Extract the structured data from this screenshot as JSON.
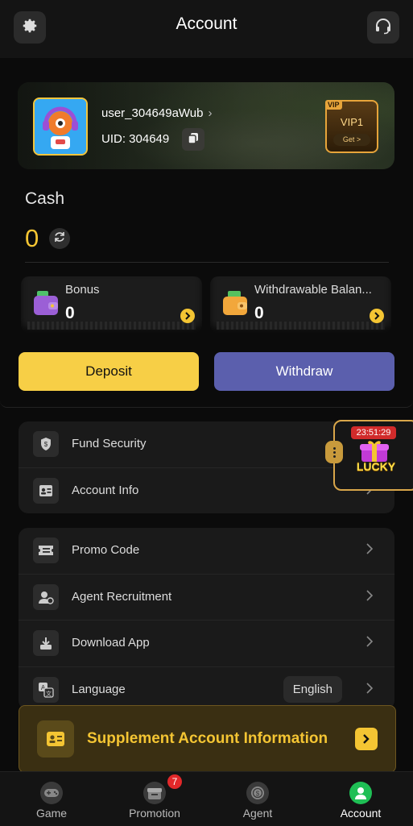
{
  "header": {
    "title": "Account",
    "settings_icon": "gear-icon",
    "support_icon": "headset-icon"
  },
  "profile": {
    "username": "user_304649aWub",
    "uid_label": "UID: 304649",
    "vip": {
      "level": "VIP1",
      "corner": "VIP",
      "get_label": "Get >"
    }
  },
  "cash": {
    "label": "Cash",
    "value": "0"
  },
  "balances": [
    {
      "label": "Bonus",
      "value": "0",
      "icon": "wallet-icon"
    },
    {
      "label": "Withdrawable Balan...",
      "value": "0",
      "icon": "money-wallet-icon"
    }
  ],
  "actions": {
    "deposit": "Deposit",
    "withdraw": "Withdraw"
  },
  "lucky": {
    "timer": "23:51:29",
    "label": "LUCKY"
  },
  "group1": [
    {
      "label": "Fund Security",
      "icon": "shield-icon"
    },
    {
      "label": "Account Info",
      "icon": "id-card-icon"
    }
  ],
  "group2": [
    {
      "label": "Promo Code",
      "icon": "ticket-icon"
    },
    {
      "label": "Agent Recruitment",
      "icon": "user-plus-icon"
    },
    {
      "label": "Download App",
      "icon": "download-icon"
    },
    {
      "label": "Language",
      "icon": "translate-icon",
      "value": "English"
    }
  ],
  "supplement": {
    "label": "Supplement Account Information"
  },
  "nav": [
    {
      "label": "Game",
      "icon": "gamepad-icon",
      "active": false
    },
    {
      "label": "Promotion",
      "icon": "gift-box-icon",
      "badge": "7",
      "active": false
    },
    {
      "label": "Agent",
      "icon": "coin-icon",
      "active": false
    },
    {
      "label": "Account",
      "icon": "user-icon",
      "active": true
    }
  ],
  "colors": {
    "accent": "#f7cf46",
    "withdraw": "#5b5fad",
    "nav_active": "#1fbf55",
    "badge": "#e2282a"
  }
}
